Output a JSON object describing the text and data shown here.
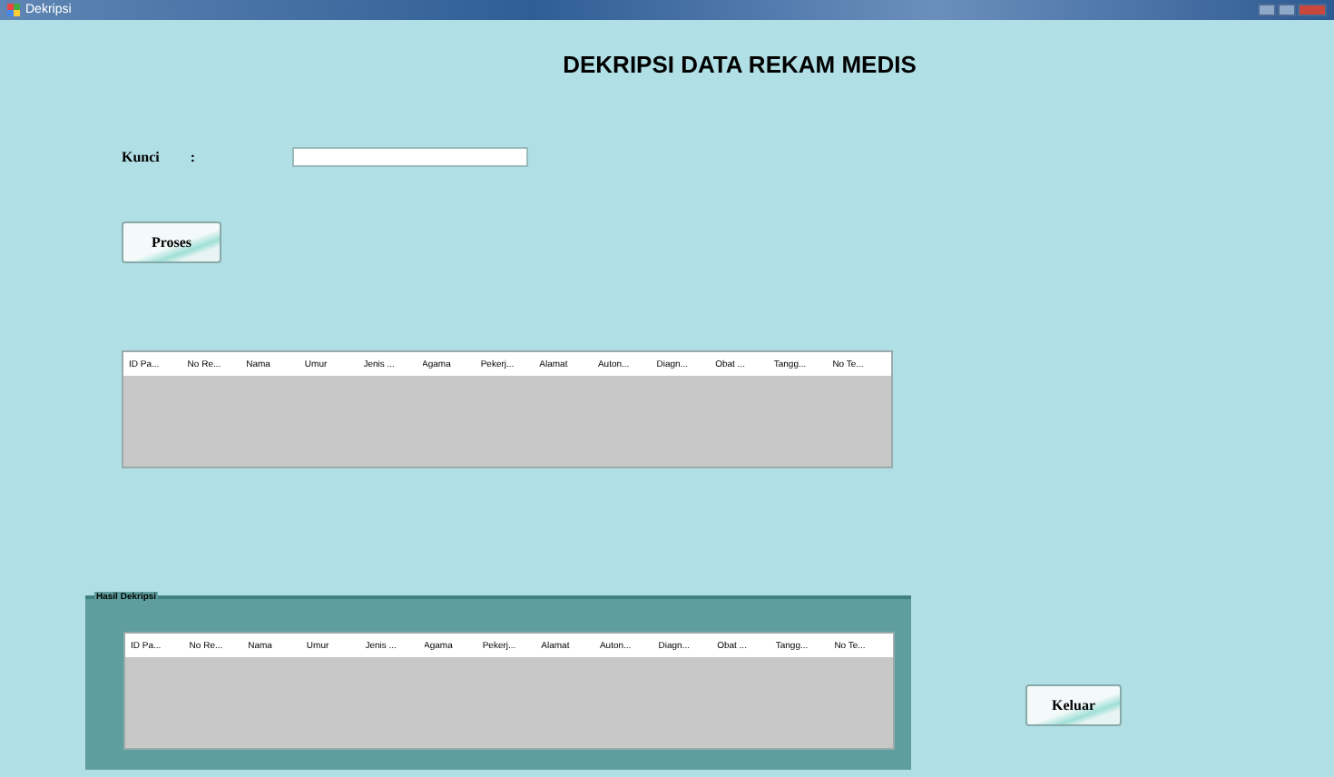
{
  "window": {
    "title": "Dekripsi"
  },
  "heading": "DEKRIPSI DATA REKAM MEDIS",
  "key_field": {
    "label": "Kunci",
    "separator": ":"
  },
  "process_button": "Proses",
  "table": {
    "columns": [
      "ID Pa...",
      "No Re...",
      "Nama",
      "Umur",
      "Jenis ...",
      "Agama",
      "Pekerj...",
      "Alamat",
      "Auton...",
      "Diagn...",
      "Obat ...",
      "Tangg...",
      "No Te..."
    ]
  },
  "result_group": {
    "title": "Hasil Dekripsi",
    "table": {
      "columns": [
        "ID Pa...",
        "No Re...",
        "Nama",
        "Umur",
        "Jenis ...",
        "Agama",
        "Pekerj...",
        "Alamat",
        "Auton...",
        "Diagn...",
        "Obat ...",
        "Tangg...",
        "No Te..."
      ]
    }
  },
  "exit_button": "Keluar"
}
